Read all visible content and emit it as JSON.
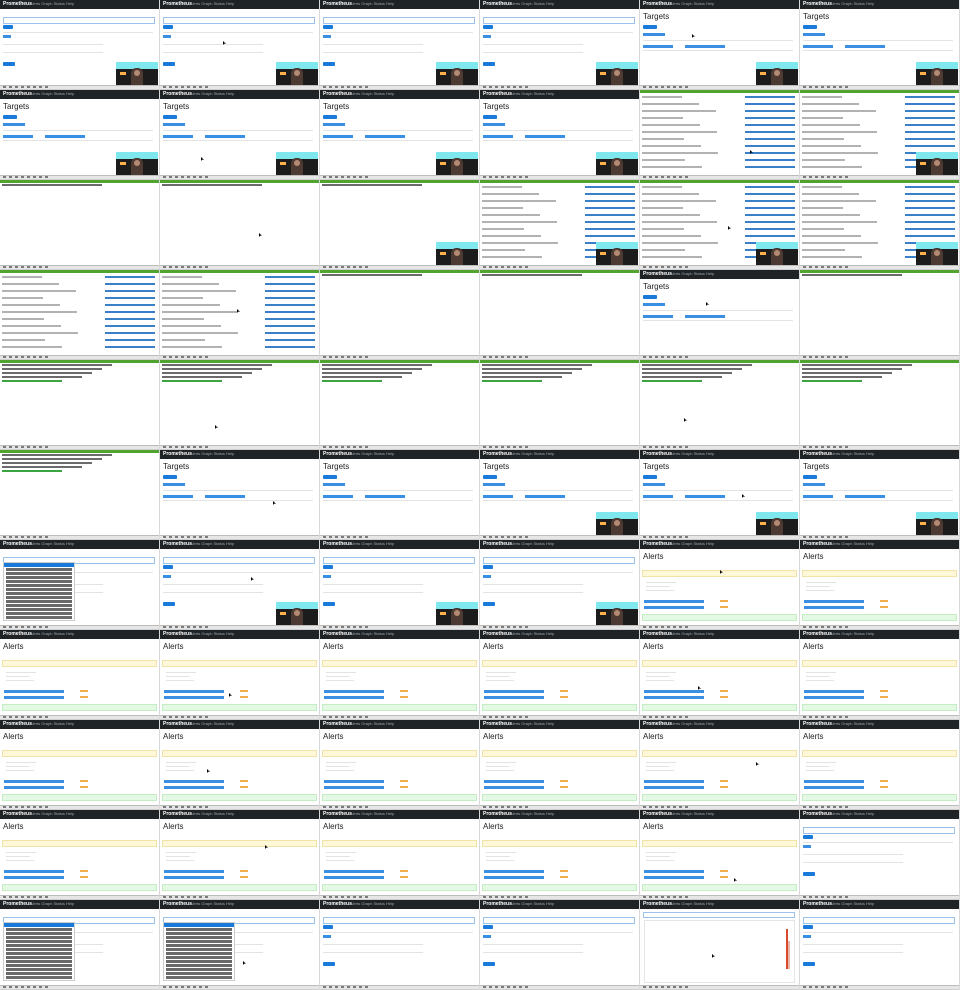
{
  "nav": {
    "brand": "Prometheus",
    "links": "Alerts  Graph  Status  Help"
  },
  "page_titles": {
    "targets": "Targets",
    "alerts": "Alerts"
  },
  "colors": {
    "navbar": "#1f2326",
    "primary": "#1a7ad9",
    "warning_bg": "#fff8d8",
    "success_bg": "#e4f9e4",
    "terminal_accent": "#3aa541",
    "graph_line": "#d94a2c"
  },
  "cells": [
    "graph",
    "graph",
    "graph",
    "graph",
    "targets",
    "targets",
    "targets",
    "targets",
    "targets",
    "targets",
    "terminal-log",
    "terminal-log",
    "terminal-empty",
    "terminal-empty",
    "terminal-empty",
    "terminal-log",
    "terminal-log",
    "terminal-log",
    "terminal-log",
    "terminal-log",
    "terminal-empty",
    "terminal-empty",
    "targets",
    "terminal-empty",
    "terminal-cmd",
    "terminal-cmd",
    "terminal-cmd",
    "terminal-cmd",
    "terminal-cmd",
    "terminal-cmd",
    "terminal-cmd",
    "targets",
    "targets",
    "targets",
    "targets",
    "targets",
    "graph-dropdown",
    "graph",
    "graph",
    "graph",
    "alerts",
    "alerts",
    "alerts",
    "alerts",
    "alerts",
    "alerts",
    "alerts",
    "alerts",
    "alerts",
    "alerts",
    "alerts",
    "alerts",
    "alerts",
    "alerts",
    "alerts",
    "alerts",
    "alerts",
    "alerts",
    "alerts",
    "graph",
    "graph-dropdown",
    "graph-dropdown",
    "graph",
    "graph",
    "graph-plot",
    "graph"
  ],
  "webcam_cells": [
    0,
    1,
    2,
    3,
    4,
    5,
    6,
    7,
    8,
    9,
    11,
    14,
    15,
    16,
    17,
    33,
    34,
    35,
    37,
    38,
    39
  ]
}
